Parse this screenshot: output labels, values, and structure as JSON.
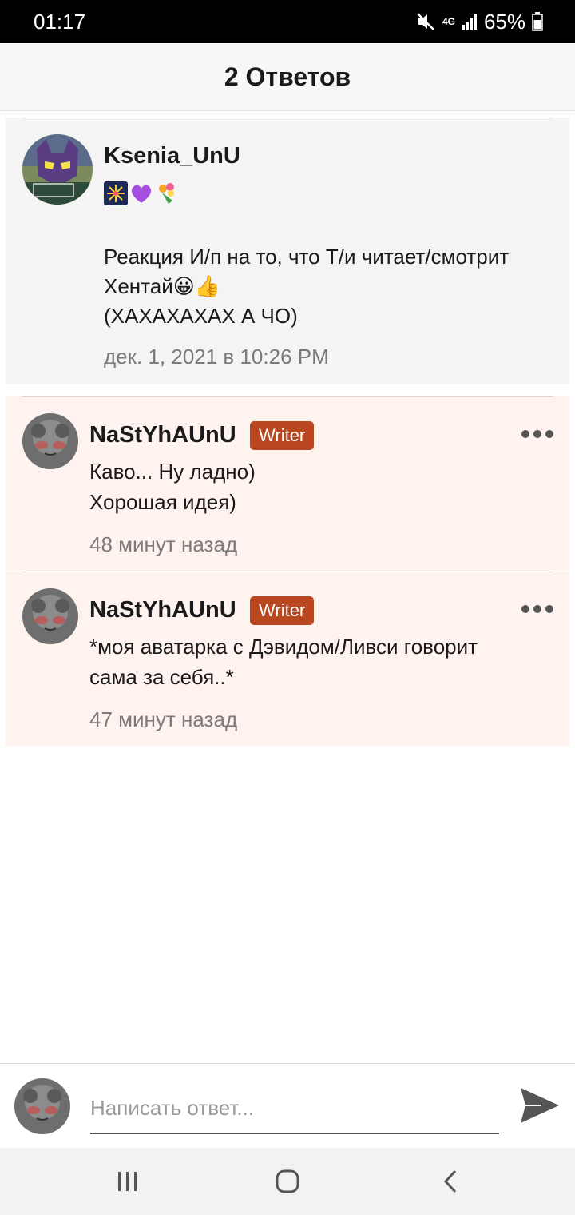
{
  "status_bar": {
    "time": "01:17",
    "network": "4G",
    "battery": "65%"
  },
  "header": {
    "title": "2 Ответов"
  },
  "original_post": {
    "author": "Ksenia_UnU",
    "emojis": [
      "fireworks-emoji",
      "purple-heart-emoji",
      "bouquet-emoji"
    ],
    "text_line1": "Реакция И/п на то, что Т/и читает/смотрит",
    "text_line2": "Хентай😀👍",
    "text_line3": "(ХАХАХАХАХ А ЧО)",
    "timestamp": "дек. 1, 2021 в 10:26 PM"
  },
  "replies": [
    {
      "author": "NaStYhAUnU",
      "badge": "Writer",
      "text_line1": "Каво... Ну ладно)",
      "text_line2": "Хорошая идея)",
      "timestamp": "48 минут назад"
    },
    {
      "author": "NaStYhAUnU",
      "badge": "Writer",
      "text_line1": "*моя аватарка с Дэвидом/Ливси говорит",
      "text_line2": "сама за себя..*",
      "timestamp": "47 минут назад"
    }
  ],
  "compose": {
    "placeholder": "Написать ответ..."
  },
  "colors": {
    "badge": "#b9471f",
    "reply_bg": "#fff3f0",
    "op_bg": "#f4f4f4"
  }
}
